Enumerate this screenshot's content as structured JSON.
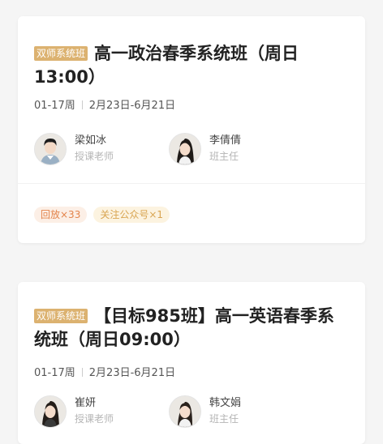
{
  "courses": [
    {
      "tag": "双师系统班",
      "title": "高一政治春季系统班（周日13:00）",
      "weeks": "01-17周",
      "dates": "2月23日-6月21日",
      "teachers": [
        {
          "name": "梁如冰",
          "role": "授课老师"
        },
        {
          "name": "李倩倩",
          "role": "班主任"
        }
      ],
      "badges": [
        "回放×33",
        "关注公众号×1"
      ]
    },
    {
      "tag": "双师系统班",
      "title": "【目标985班】高一英语春季系统班（周日09:00）",
      "weeks": "01-17周",
      "dates": "2月23日-6月21日",
      "teachers": [
        {
          "name": "崔妍",
          "role": "授课老师"
        },
        {
          "name": "韩文娟",
          "role": "班主任"
        }
      ]
    }
  ],
  "colors": {
    "background": "#f5f5f5",
    "tag": "#dcb270",
    "badge_replay_text": "#e3844b",
    "badge_follow_text": "#d9a552"
  }
}
